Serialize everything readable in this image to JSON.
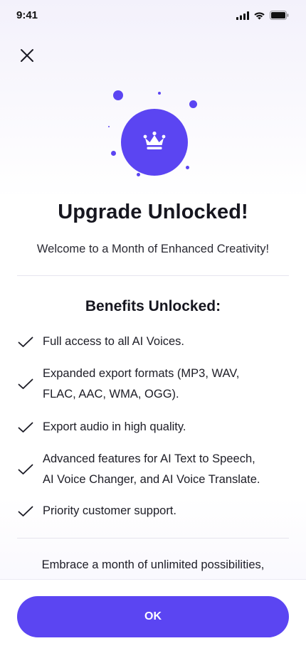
{
  "status_bar": {
    "time": "9:41"
  },
  "header": {
    "close_icon": "close-icon"
  },
  "hero": {
    "icon": "crown-icon",
    "accent_color": "#5b45f2"
  },
  "title": "Upgrade Unlocked!",
  "subtitle": "Welcome to a Month of Enhanced Creativity!",
  "benefits": {
    "heading": "Benefits Unlocked:",
    "items": [
      {
        "line1": "Full access to all AI Voices.",
        "line2": ""
      },
      {
        "line1": "Expanded export formats (MP3, WAV,",
        "line2": "FLAC, AAC, WMA, OGG)."
      },
      {
        "line1": "Export audio in high quality.",
        "line2": ""
      },
      {
        "line1": "Advanced features for AI Text to Speech,",
        "line2": "AI Voice Changer, and AI Voice Translate."
      },
      {
        "line1": "Priority customer support.",
        "line2": ""
      }
    ]
  },
  "footer_text": "Embrace a month of unlimited possibilities,",
  "ok_button": {
    "label": "OK"
  }
}
